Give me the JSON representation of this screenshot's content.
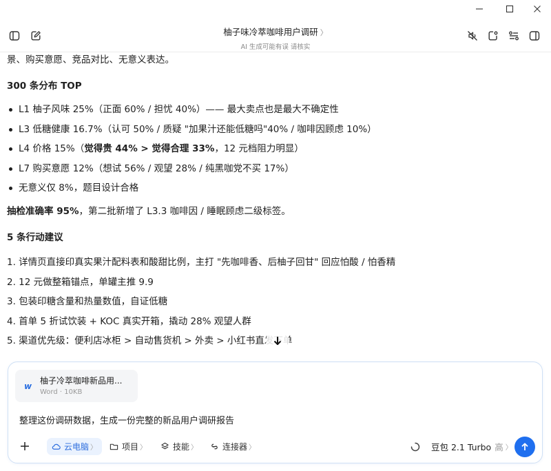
{
  "window": {
    "minimize_icon": "minimize-icon",
    "maximize_icon": "maximize-icon",
    "close_icon": "close-icon"
  },
  "header": {
    "title": "柚子味冷萃咖啡用户调研",
    "title_chevron": "〉",
    "subtitle": "AI 生成可能有误 请核实"
  },
  "content": {
    "cut_line": "景、购买意愿、竞品对比、无意义表达。",
    "section1_title": "300 条分布 TOP",
    "dist": [
      "L1 柚子风味 25%（正面 60% / 担忧 40%）—— 最大卖点也是最大不确定性",
      "L3 低糖健康 16.7%（认可 50% / 质疑 \"加果汁还能低糖吗\"40% / 咖啡因顾虑 10%）",
      {
        "pre": "L4 价格 15%（",
        "bold": "觉得贵 44% > 觉得合理 33%",
        "post": "，12 元档阻力明显）"
      },
      "L7 购买意愿 12%（想试 56% / 观望 28% / 纯黑咖党不买 17%）",
      "无意义仅 8%，题目设计合格"
    ],
    "accuracy_bold": "抽检准确率 95%",
    "accuracy_rest": "，第二批新增了 L3.3 咖啡因 / 睡眠顾虑二级标签。",
    "section2_title": "5 条行动建议",
    "actions": [
      "1. 详情页直接印真实果汁配料表和酸甜比例，主打 \"先咖啡香、后柚子回甘\" 回应怕酸 / 怕香精",
      "2. 12 元做整箱锚点，单罐主推 9.9",
      "3. 包装印糖含量和热量数值，自证低糖",
      "4. 首单 5 折试饮装 + KOC 真实开箱，撬动 28% 观望人群",
      "5. 渠道优先级：便利店冰柜 > 自动售货机 > 外卖 > 小红书直发下单"
    ]
  },
  "composer": {
    "attachment_name": "柚子冷萃咖啡新品用...",
    "attachment_meta": "Word · 10KB",
    "prompt_text": "整理这份调研数据，生成一份完整的新品用户调研报告",
    "chips": [
      {
        "label": "云电脑",
        "icon": "cloud-icon"
      },
      {
        "label": "项目",
        "icon": "folder-icon"
      },
      {
        "label": "技能",
        "icon": "skill-icon"
      },
      {
        "label": "连接器",
        "icon": "connector-icon"
      }
    ],
    "chip_chevron": "〉",
    "model_name": "豆包 2.1 Turbo",
    "model_tier": "高",
    "model_chevron": "〉"
  },
  "colors": {
    "accent": "#1f6fef",
    "chip_active_bg": "#eaf2fe",
    "chip_active_text": "#2f6fde"
  }
}
